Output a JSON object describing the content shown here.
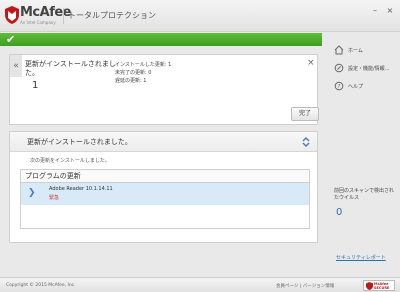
{
  "brand": {
    "name": "McAfee",
    "sub": "An Intel Company",
    "accent": "#c01818"
  },
  "window": {
    "title": "トータルプロテクション",
    "minimize": "–",
    "close": "×"
  },
  "status": {
    "color": "#4caf2a",
    "icon": "check-icon"
  },
  "notification": {
    "back": "«",
    "title": "更新がインストールされました。",
    "count": "1",
    "stats": [
      "インストールした更新: 1",
      "未完了の更新: 0",
      "遅延の更新: 1"
    ],
    "close": "×",
    "done_button": "完了"
  },
  "installed": {
    "title": "更新がインストールされました。",
    "message": "次の更新をインストールしました。",
    "table_header": "プログラムの更新",
    "rows": [
      {
        "name": "Adobe Reader 10.1.14.11",
        "priority": "緊急"
      }
    ]
  },
  "sidebar": {
    "items": [
      {
        "label": "ホーム",
        "icon": "home-icon"
      },
      {
        "label": "設定・機能/情報…",
        "icon": "settings-icon"
      },
      {
        "label": "ヘルプ",
        "icon": "help-icon"
      }
    ],
    "scan_label": "前回のスキャンで検出されたウイルス",
    "scan_count": "0",
    "security_report": "セキュリティレポート"
  },
  "footer": {
    "copyright": "Copyright © 2015 McAfee, Inc.",
    "links": "会員ページ | バージョン情報",
    "badge": [
      "McAfee",
      "SECURE"
    ]
  }
}
